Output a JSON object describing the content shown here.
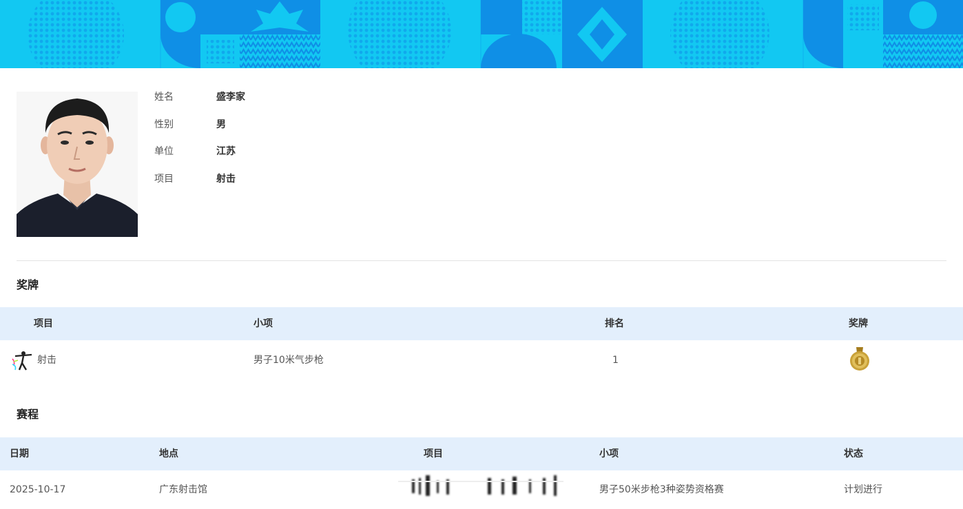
{
  "profile": {
    "fields": [
      {
        "label": "姓名",
        "value": "盛李家"
      },
      {
        "label": "性别",
        "value": "男"
      },
      {
        "label": "单位",
        "value": "江苏"
      },
      {
        "label": "项目",
        "value": "射击"
      }
    ]
  },
  "medals": {
    "title": "奖牌",
    "headers": [
      "项目",
      "小项",
      "排名",
      "奖牌"
    ],
    "rows": [
      {
        "sport": "射击",
        "sport_icon": "shooting-icon",
        "event": "男子10米气步枪",
        "rank": "1",
        "medal": "gold-medal-icon"
      }
    ]
  },
  "schedule": {
    "title": "赛程",
    "headers": [
      "日期",
      "地点",
      "项目",
      "小项",
      "状态"
    ],
    "rows": [
      {
        "date": "2025-10-17",
        "venue": "广东射击馆",
        "sport": "",
        "event": "男子50米步枪3种姿势资格赛",
        "status": "计划进行"
      }
    ]
  },
  "colors": {
    "banner_light": "#12c8f2",
    "banner_dark": "#0f8fe6",
    "table_header_bg": "#e3effc",
    "medal_gold": "#c9a23a"
  }
}
